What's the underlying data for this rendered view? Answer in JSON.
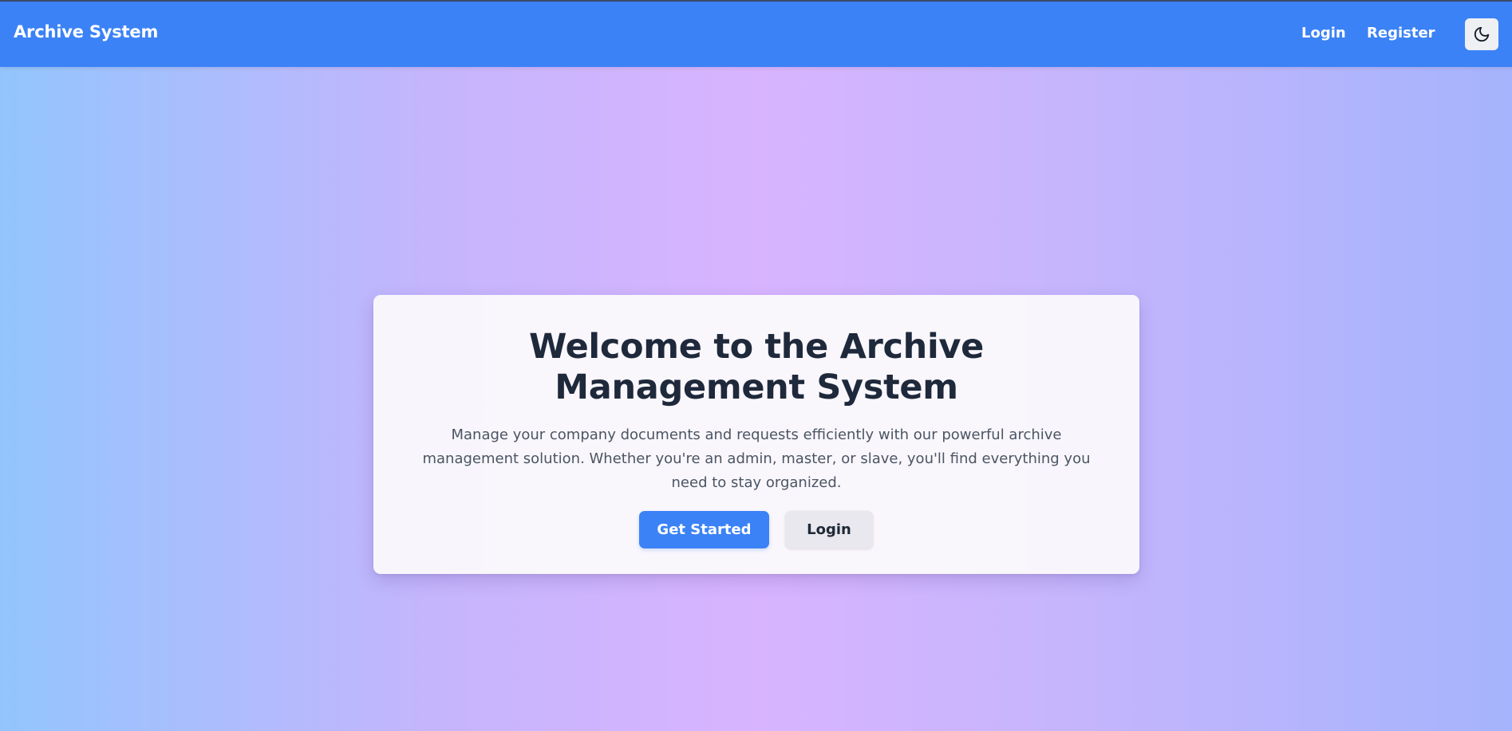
{
  "navbar": {
    "brand": "Archive System",
    "links": [
      {
        "label": "Login"
      },
      {
        "label": "Register"
      }
    ],
    "theme_toggle_icon": "moon-icon"
  },
  "hero": {
    "title": "Welcome to the Archive Management System",
    "description": "Manage your company documents and requests efficiently with our powerful archive management solution. Whether you're an admin, master, or slave, you'll find everything you need to stay organized.",
    "primary_button": "Get Started",
    "secondary_button": "Login"
  },
  "colors": {
    "navbar": "#3b82f6",
    "primary_button": "#3b82f6",
    "secondary_button": "#e8e8ee",
    "title_text": "#1e293b",
    "body_text": "#4b5563",
    "gradient_left": "#93c5fd",
    "gradient_center": "#d8b4fe",
    "gradient_right": "#a5b4fc"
  }
}
